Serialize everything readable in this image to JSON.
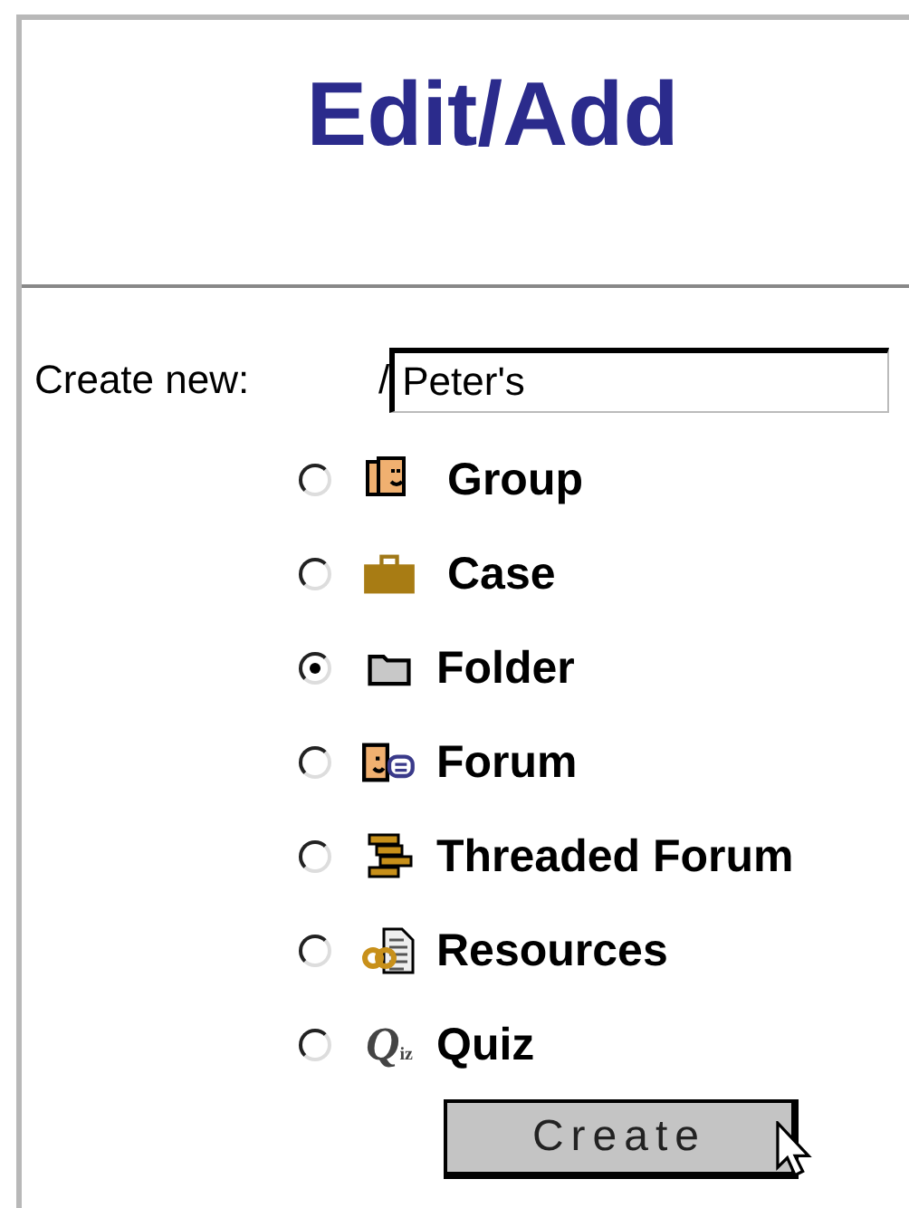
{
  "title": "Edit/Add",
  "create_new": {
    "label": "Create new:",
    "prefix": "/",
    "value": "Peter's"
  },
  "options": [
    {
      "kind": "group",
      "label": "Group",
      "selected": false
    },
    {
      "kind": "case",
      "label": "Case",
      "selected": false
    },
    {
      "kind": "folder",
      "label": "Folder",
      "selected": true
    },
    {
      "kind": "forum",
      "label": "Forum",
      "selected": false
    },
    {
      "kind": "threaded",
      "label": "Threaded Forum",
      "selected": false
    },
    {
      "kind": "resources",
      "label": "Resources",
      "selected": false
    },
    {
      "kind": "quiz",
      "label": "Quiz",
      "selected": false,
      "icon_text": "Q$_{iz}$"
    }
  ],
  "button": {
    "label": "Create"
  }
}
